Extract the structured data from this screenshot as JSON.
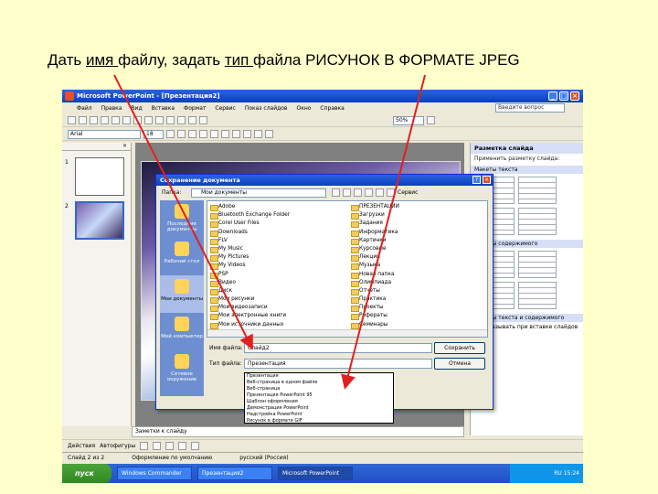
{
  "caption": {
    "part1": "Дать ",
    "link1": "имя ",
    "part2": "файлу, задать ",
    "link2": "тип ",
    "part3": "файла РИСУНОК В ФОРМАТЕ JPEG"
  },
  "app": {
    "title": "Microsoft PowerPoint - [Презентация2]",
    "help_placeholder": "Введите вопрос",
    "menu": [
      "Файл",
      "Правка",
      "Вид",
      "Вставка",
      "Формат",
      "Сервис",
      "Показ слайдов",
      "Окно",
      "Справка"
    ],
    "font_name": "Arial",
    "font_size": "18",
    "zoom": "50%",
    "slide_numbers": [
      "1",
      "2"
    ],
    "notes_text": "Заметки к слайду",
    "status": [
      "Слайд 2 из 2",
      "Оформление по умолчанию",
      "русский (Россия)"
    ],
    "draw_bar": [
      "Действия",
      "Автофигуры"
    ],
    "colors": {
      "titlebar": "#0a3fbf",
      "background": "#ffffcc",
      "selection": "#316ac5"
    }
  },
  "taskpane": {
    "title": "Разметка слайда",
    "apply_label": "Применить разметку слайда:",
    "section_text": "Макеты текста",
    "section_content": "Макеты содержимого",
    "section_text_content": "Макеты текста и содержимого",
    "checkbox": "Показывать при вставке слайдов"
  },
  "dialog": {
    "title": "Сохранение документа",
    "look_in_label": "Папка:",
    "look_in_value": "Мои документы",
    "tools_label": "Сервис",
    "places": [
      "Последние документы",
      "Рабочий стол",
      "Мои документы",
      "Мой компьютер",
      "Сетевое окружение"
    ],
    "files_left": [
      "Adobe",
      "Bluetooth Exchange Folder",
      "Corel User Files",
      "Downloads",
      "FLV",
      "My Music",
      "My Pictures",
      "My Videos",
      "PSP",
      "Видео",
      "Диск",
      "Мои рисунки",
      "Мои видеозаписи",
      "Мои электронные книги",
      "Мои источники данных",
      "Мои фигуры"
    ],
    "files_right": [
      "ПРЕЗЕНТАЦИИ",
      "Загрузки",
      "Задания",
      "Информатика",
      "Картинки",
      "Курсовые",
      "Лекции",
      "Музыка",
      "Новая папка",
      "Олимпиада",
      "Отчеты",
      "Практика",
      "Проекты",
      "Рефераты",
      "Семинары",
      "Учебники"
    ],
    "filename_label": "Имя файла:",
    "filename_value": "Слайд2",
    "filetype_label": "Тип файла:",
    "filetype_value": "Презентация",
    "save_button": "Сохранить",
    "cancel_button": "Отмена",
    "filetype_options": [
      "Презентация",
      "Веб-страница в одном файле",
      "Веб-страница",
      "Презентация PowerPoint 95",
      "Шаблон оформления",
      "Демонстрация PowerPoint",
      "Надстройка PowerPoint",
      "Рисунок в формате GIF",
      "Рисунок в формате JPEG",
      "Рисунок в формате PNG",
      "Рисунок в формате TIFF"
    ],
    "selected_option_index": 8
  },
  "taskbar": {
    "start": "пуск",
    "tasks": [
      "Windows Commander",
      "Презентация2",
      "Microsoft PowerPoint"
    ],
    "tray": "RU  15:24"
  }
}
